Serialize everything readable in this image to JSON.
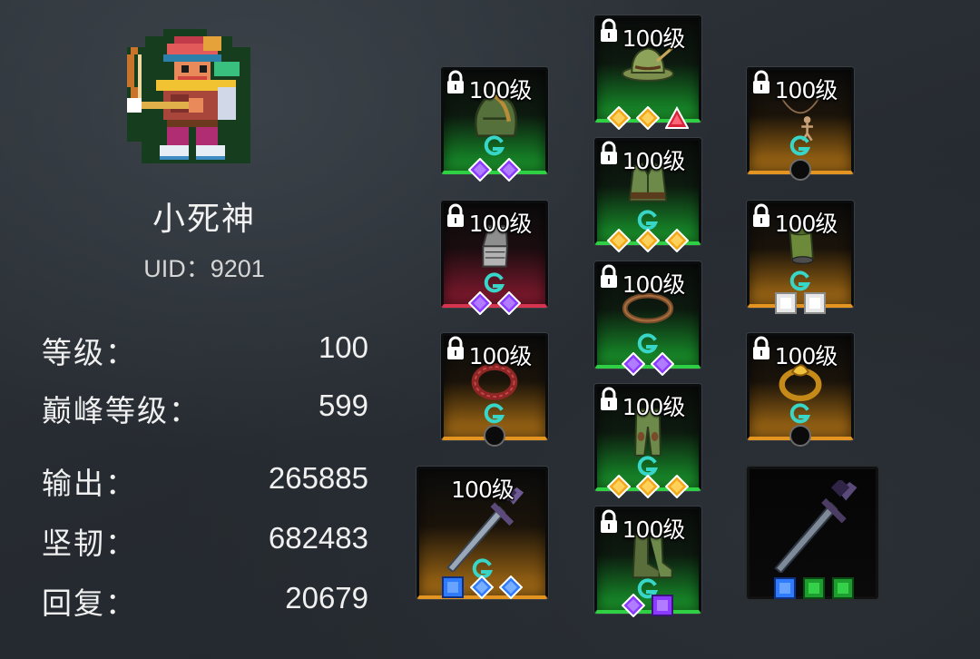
{
  "player": {
    "name": "小死神",
    "uid": "UID：9201"
  },
  "stats": [
    {
      "label": "等级：",
      "value": "100"
    },
    {
      "label": "巅峰等级：",
      "value": "599"
    },
    {
      "label": "输出：",
      "value": "265885"
    },
    {
      "label": "坚韧：",
      "value": "682483"
    },
    {
      "label": "回复：",
      "value": "20679"
    }
  ],
  "equipment": [
    {
      "slot": "helmet",
      "level": "100级",
      "locked": true,
      "rarity": "green",
      "icon": "helmet-icon",
      "gems": [
        "purple",
        "purple"
      ]
    },
    {
      "slot": "hat",
      "level": "100级",
      "locked": true,
      "rarity": "green",
      "icon": "hat-icon",
      "gems": [
        "gold",
        "gold",
        "red-triangle"
      ]
    },
    {
      "slot": "amulet",
      "level": "100级",
      "locked": true,
      "rarity": "orange",
      "icon": "amulet-icon",
      "gems": [
        "empty"
      ]
    },
    {
      "slot": "chest",
      "level": "100级",
      "locked": true,
      "rarity": "green",
      "icon": "chest-armor-icon",
      "gems": [
        "gold",
        "gold",
        "gold"
      ]
    },
    {
      "slot": "gloves",
      "level": "100级",
      "locked": true,
      "rarity": "red",
      "icon": "gauntlet-icon",
      "gems": [
        "purple",
        "purple"
      ]
    },
    {
      "slot": "bracer",
      "level": "100级",
      "locked": true,
      "rarity": "orange",
      "icon": "bracer-icon",
      "gems": [
        "white",
        "white"
      ]
    },
    {
      "slot": "belt",
      "level": "100级",
      "locked": true,
      "rarity": "green",
      "icon": "belt-icon",
      "gems": [
        "purple",
        "purple"
      ]
    },
    {
      "slot": "ring-left",
      "level": "100级",
      "locked": true,
      "rarity": "orange",
      "icon": "ring-icon",
      "gems": [
        "empty"
      ]
    },
    {
      "slot": "ring-right",
      "level": "100级",
      "locked": true,
      "rarity": "orange",
      "icon": "gold-ring-icon",
      "gems": [
        "empty"
      ]
    },
    {
      "slot": "pants",
      "level": "100级",
      "locked": true,
      "rarity": "green",
      "icon": "pants-icon",
      "gems": [
        "gold",
        "gold",
        "gold"
      ]
    },
    {
      "slot": "weapon",
      "level": "100级",
      "locked": false,
      "rarity": "orange",
      "icon": "sword-icon",
      "gems": [
        "blue-square",
        "blue",
        "blue"
      ]
    },
    {
      "slot": "boots",
      "level": "100级",
      "locked": true,
      "rarity": "green",
      "icon": "boots-icon",
      "gems": [
        "purple",
        "purple-square"
      ]
    },
    {
      "slot": "offhand",
      "level": "",
      "locked": false,
      "rarity": "black",
      "icon": "sword-icon",
      "gems": [
        "blue-square",
        "green-square",
        "green-square"
      ]
    }
  ],
  "colors": {
    "green_rarity": "#2fd043",
    "orange_rarity": "#e49421",
    "red_rarity": "#d7344f",
    "gem_purple": "#8a3bff",
    "gem_gold": "#f3a81a",
    "gem_blue": "#2f7bff",
    "mark_cyan": "#37d6c8"
  }
}
